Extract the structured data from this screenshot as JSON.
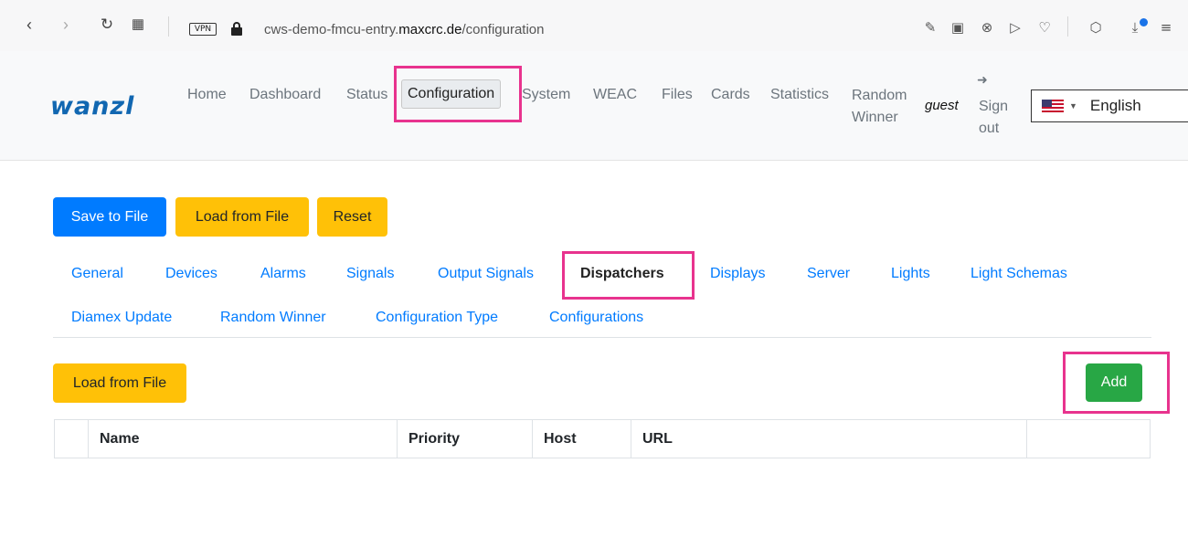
{
  "browser": {
    "back_icon": "back-arrow-icon",
    "forward_icon": "forward-arrow-icon",
    "reload_icon": "reload-icon",
    "grid_icon": "app-grid-icon",
    "vpn_label": "VPN",
    "url_prefix": "cws-demo-fmcu-entry.",
    "url_domain": "maxcrc.de",
    "url_path": "/configuration",
    "right_icons": [
      "edit-icon",
      "camera-icon",
      "shield-x-icon",
      "send-icon",
      "heart-icon",
      "cube-icon",
      "download-icon",
      "menu-icon"
    ]
  },
  "header": {
    "logo": "wanzl",
    "nav": {
      "home": "Home",
      "dashboard": "Dashboard",
      "status": "Status",
      "configuration": "Configuration",
      "system": "System",
      "weac": "WEAC",
      "files": "Files",
      "cards": "Cards",
      "statistics": "Statistics",
      "random_winner": "Random Winner"
    },
    "user": "guest",
    "signout": "Sign out",
    "language": "English"
  },
  "toolbar": {
    "save_to_file": "Save to File",
    "load_from_file": "Load from File",
    "reset": "Reset"
  },
  "tabs": {
    "general": "General",
    "devices": "Devices",
    "alarms": "Alarms",
    "signals": "Signals",
    "output_signals": "Output Signals",
    "dispatchers": "Dispatchers",
    "displays": "Displays",
    "server": "Server",
    "lights": "Lights",
    "light_schemas": "Light Schemas",
    "diamex_update": "Diamex Update",
    "random_winner": "Random Winner",
    "configuration_type": "Configuration Type",
    "configurations": "Configurations"
  },
  "dispatchers": {
    "load_from_file": "Load from File",
    "add": "Add",
    "columns": {
      "name": "Name",
      "priority": "Priority",
      "host": "Host",
      "url": "URL"
    }
  },
  "colors": {
    "primary": "#007bff",
    "warning": "#ffc107",
    "success": "#28a745",
    "highlight": "#e8338e",
    "logo": "#1167b1"
  }
}
